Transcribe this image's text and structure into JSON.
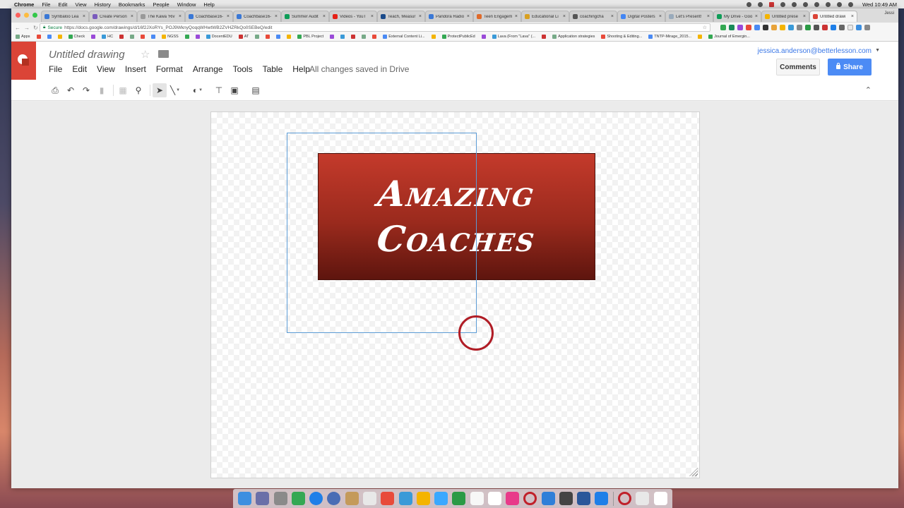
{
  "menubar": {
    "app": "Chrome",
    "items": [
      "File",
      "Edit",
      "View",
      "History",
      "Bookmarks",
      "People",
      "Window",
      "Help"
    ],
    "clock": "Wed 10:49 AM"
  },
  "tabs": [
    {
      "label": "Symbaloo Lea",
      "color": "#3a78d6"
    },
    {
      "label": "Create Person",
      "color": "#7a5bbd"
    },
    {
      "label": "The Kawa 'Riv",
      "color": "#999999"
    },
    {
      "label": "Coachbase16-",
      "color": "#3a78d6"
    },
    {
      "label": "Coachbase16-",
      "color": "#3a78d6"
    },
    {
      "label": "Summer Audit",
      "color": "#0f9d58"
    },
    {
      "label": "Videos - YouT",
      "color": "#e62117"
    },
    {
      "label": "Teach, Measur",
      "color": "#1a4a8a"
    },
    {
      "label": "Pandora Radio",
      "color": "#3a78d6"
    },
    {
      "label": "Teen Engagem",
      "color": "#e06a2a"
    },
    {
      "label": "Educational Li",
      "color": "#d9a020"
    },
    {
      "label": "coachingcha",
      "color": "#555555"
    },
    {
      "label": "Digital Posters",
      "color": "#4285f4"
    },
    {
      "label": "Let's Present!",
      "color": "#9ab"
    },
    {
      "label": "My Drive - Goo",
      "color": "#0f9d58"
    },
    {
      "label": "Untitled prese",
      "color": "#f4b400"
    },
    {
      "label": "Untitled drawi",
      "color": "#db4437",
      "active": true
    }
  ],
  "profile_name": "Jessi",
  "address": {
    "secure_label": "Secure",
    "url": "https://docs.google.com/drawings/d/16f2JXoRYs_POJ9WknyQoqqWHwtWB2ZVHZRkQo0SEBeQ/edit"
  },
  "bookmarks": [
    "Apps",
    "",
    "",
    "",
    "Check",
    "",
    "HC",
    "",
    "",
    "",
    "",
    "NGSS",
    "",
    "",
    "DocentEDU",
    "AT",
    "",
    "",
    "",
    "",
    "PBL Project",
    "",
    "",
    "",
    "",
    "",
    "External Content Li...",
    "",
    "ProtectPublicEd",
    "",
    "Lava (From \"Lava\" (...",
    "",
    "Application strategies",
    "Shooting & Editing...",
    "TNTP-Mirage_2015...",
    "",
    "Journal of Emergin..."
  ],
  "doc": {
    "title": "Untitled drawing",
    "saved_status": "All changes saved in Drive",
    "menus": [
      "File",
      "Edit",
      "View",
      "Insert",
      "Format",
      "Arrange",
      "Tools",
      "Table",
      "Help"
    ]
  },
  "account": {
    "email": "jessica.anderson@betterlesson.com",
    "comments_label": "Comments",
    "share_label": "Share"
  },
  "toolbar_icons": [
    "print-icon",
    "undo-icon",
    "redo-icon",
    "paint-format-icon",
    "select-all-icon",
    "zoom-icon",
    "select-pointer-icon",
    "line-icon",
    "shape-icon",
    "text-box-icon",
    "image-icon",
    "comment-icon"
  ],
  "canvas": {
    "banner_line1": "Amazing",
    "banner_line2": "Coaches",
    "banner_colors": {
      "top": "#c43a2b",
      "bottom": "#5e150e"
    }
  },
  "dock_colors": [
    "#3d8fe0",
    "#6a6fa8",
    "#8a8a8a",
    "#34a853",
    "#1f7fe8",
    "#4a6db5",
    "#c49a5a",
    "#e8e8e8",
    "#e84a3a",
    "#3a9ad8",
    "#f4b400",
    "#3aa8ff",
    "#2b9a45",
    "#f7f7f7",
    "#ffffff",
    "#e83a8a",
    "#ffffff",
    "#2f7fd8",
    "#444444",
    "#2b579a",
    "#1f7fe8",
    "#ffffff",
    "#e8e8e8",
    "#ffffff"
  ]
}
